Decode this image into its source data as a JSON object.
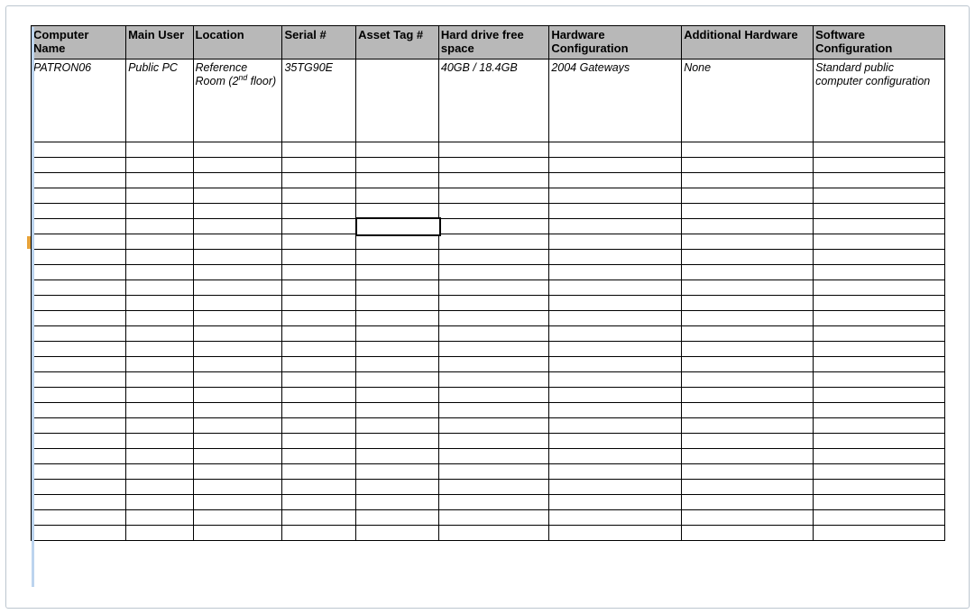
{
  "columns": [
    "Computer Name",
    "Main User",
    "Location",
    "Serial #",
    "Asset Tag #",
    "Hard drive free space",
    "Hardware Configuration",
    "Additional Hardware",
    "Software Configuration"
  ],
  "rows": [
    {
      "computer_name": "PATRON06",
      "main_user": "Public PC",
      "location": "Reference Room (2",
      "location_super": "nd",
      "location_tail": " floor)",
      "serial": "35TG90E",
      "asset_tag": "",
      "hd_free": "40GB / 18.4GB",
      "hw_config": "2004 Gateways",
      "add_hw": "None",
      "sw_config": "Standard public computer configuration"
    }
  ],
  "empty_row_count": 26,
  "selected_cell": {
    "row": 6,
    "col": 5
  }
}
